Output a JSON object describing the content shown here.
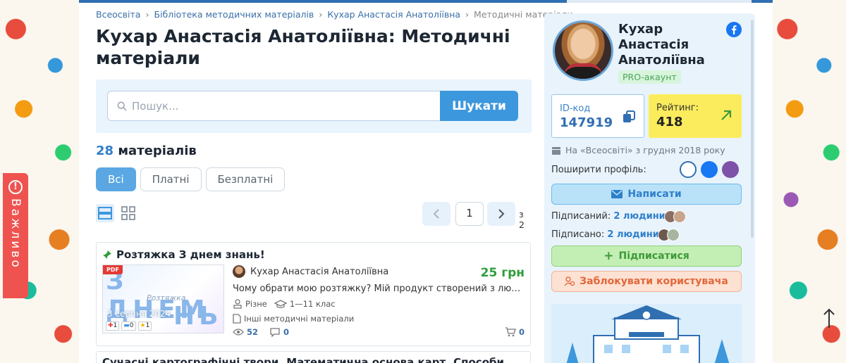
{
  "breadcrumb": {
    "items": [
      "Всеосвіта",
      "Бібліотека методичних матеріалів",
      "Кухар Анастасія Анатоліївна"
    ],
    "current": "Методичні матеріали"
  },
  "page": {
    "title": "Кухар Анастасія Анатоліївна: Методичні матеріали"
  },
  "important_tab": {
    "label": "Важливо"
  },
  "search": {
    "placeholder": "Пошук...",
    "button_label": "Шукати"
  },
  "materials": {
    "count": "28",
    "count_label": "матеріалів"
  },
  "filters": [
    "Всі",
    "Платні",
    "Безплатні"
  ],
  "filter_active": "Всі",
  "pagination": {
    "current_page": "1",
    "total_label": "з 2"
  },
  "cards": [
    {
      "title": "Розтяжка З днем знань!",
      "badge": "PDF",
      "thumb": {
        "line1": "З ДНЕМ",
        "line2": "Розтяжка",
        "line3": "НЬ!",
        "date": "3 серпня 2024"
      },
      "ratings": [
        "1",
        "0",
        "1"
      ],
      "author": "Кухар Анастасія Анатоліївна",
      "price": "25 грн",
      "description": "Чому обрати мою розтяжку? Мій продукт створений з любов...",
      "level": "Різне",
      "grades": "1—11 клас",
      "category": "Інші методичні матеріали",
      "views": "52",
      "comments": "0",
      "cart": "0"
    }
  ],
  "next_card": {
    "title": "Сучасні картографічні твори. Математична основа карт. Способи"
  },
  "profile": {
    "name": "Кухар Анастасія Анатоліївна",
    "badge": "PRO-акаунт",
    "id_label": "ID-код",
    "id_value": "147919",
    "rating_label": "Рейтинг:",
    "rating_value": "418",
    "since": "На «Всеосвіті» з грудня 2018 року",
    "share_label": "Поширити профіль:",
    "write_button": "Написати",
    "subscribers_label": "Підписаний:",
    "subscribers_value": "2 людини",
    "subscribed_label": "Підписано:",
    "subscribed_value": "2 людини",
    "subscribe_button": "Підписатися",
    "block_button": "Заблокувати користувача"
  },
  "colors": {
    "accent": "#3d97dc",
    "price": "#2e9d3a",
    "rating_bg": "#fbec5d",
    "important": "#ef5350"
  }
}
